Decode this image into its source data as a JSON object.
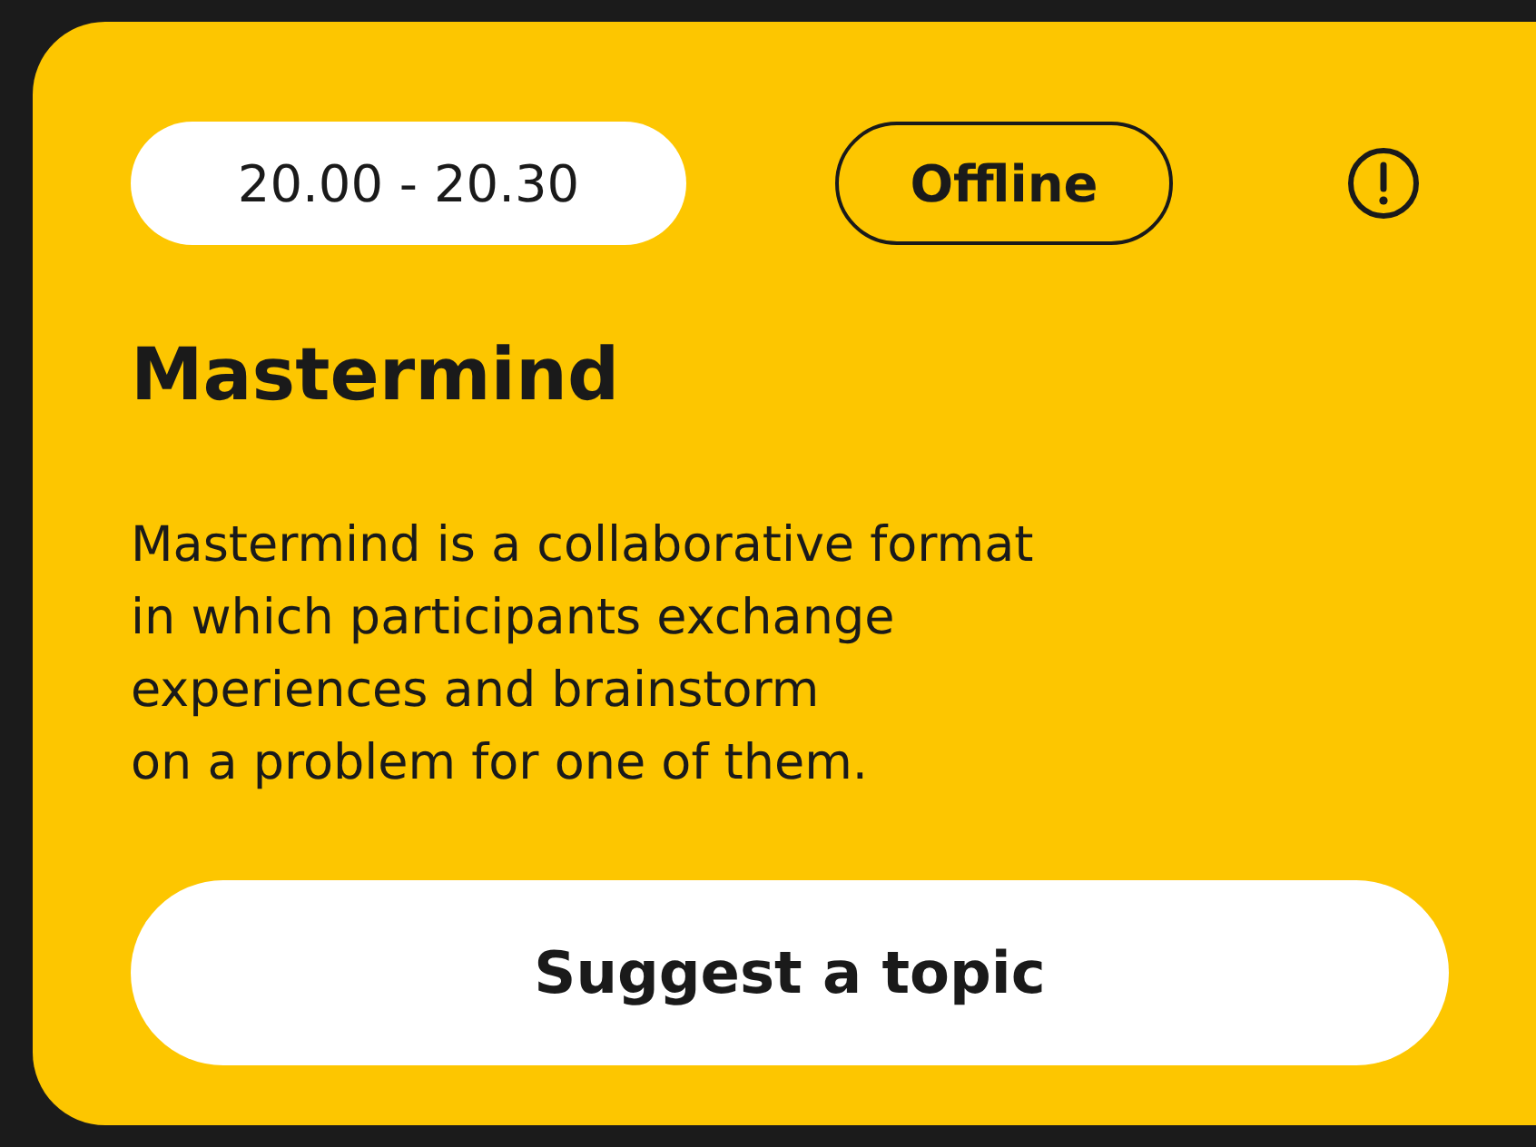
{
  "event_card": {
    "time": "20.00 - 20.30",
    "format": "Offline",
    "title": "Mastermind",
    "description_lines": [
      "Mastermind is a collaborative format",
      "in which participants exchange",
      "experiences and brainstorm",
      "on a problem for one of them."
    ],
    "button": "Suggest a topic"
  }
}
